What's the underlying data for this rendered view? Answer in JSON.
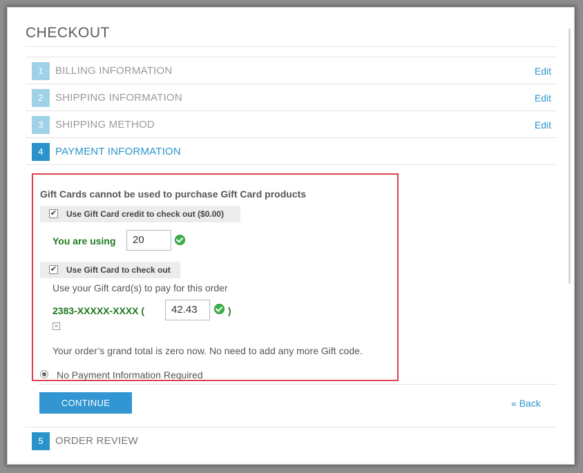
{
  "page": {
    "title": "CHECKOUT"
  },
  "steps": [
    {
      "num": "1",
      "label": "BILLING INFORMATION",
      "edit": "Edit"
    },
    {
      "num": "2",
      "label": "SHIPPING INFORMATION",
      "edit": "Edit"
    },
    {
      "num": "3",
      "label": "SHIPPING METHOD",
      "edit": "Edit"
    },
    {
      "num": "4",
      "label": "PAYMENT INFORMATION"
    },
    {
      "num": "5",
      "label": "ORDER REVIEW"
    }
  ],
  "payment": {
    "notice": "Gift Cards cannot be used to purchase Gift Card products",
    "credit_option": {
      "label": "Use Gift Card credit to check out ($0.00)",
      "checked": true
    },
    "using_label": "You are using",
    "using_value": "20",
    "giftcard_option": {
      "label": "Use Gift Card to check out",
      "checked": true
    },
    "giftcard_hint": "Use your Gift card(s) to pay for this order",
    "card_code": "2383-XXXXX-XXXX (",
    "card_amount": "42.43",
    "card_close": ")",
    "zero_total_msg": "Your order’s grand total is zero now. No need to add any more Gift code.",
    "method_label": "No Payment Information Required",
    "checkbox_glyph": "✔",
    "remove_glyph": "×"
  },
  "actions": {
    "continue_label": "CONTINUE",
    "back_label": "« Back"
  },
  "colors": {
    "accent": "#2b93cc",
    "inactive_step": "#9fd1e8",
    "highlight_border": "#d9434f",
    "success": "#1f7a1f"
  }
}
